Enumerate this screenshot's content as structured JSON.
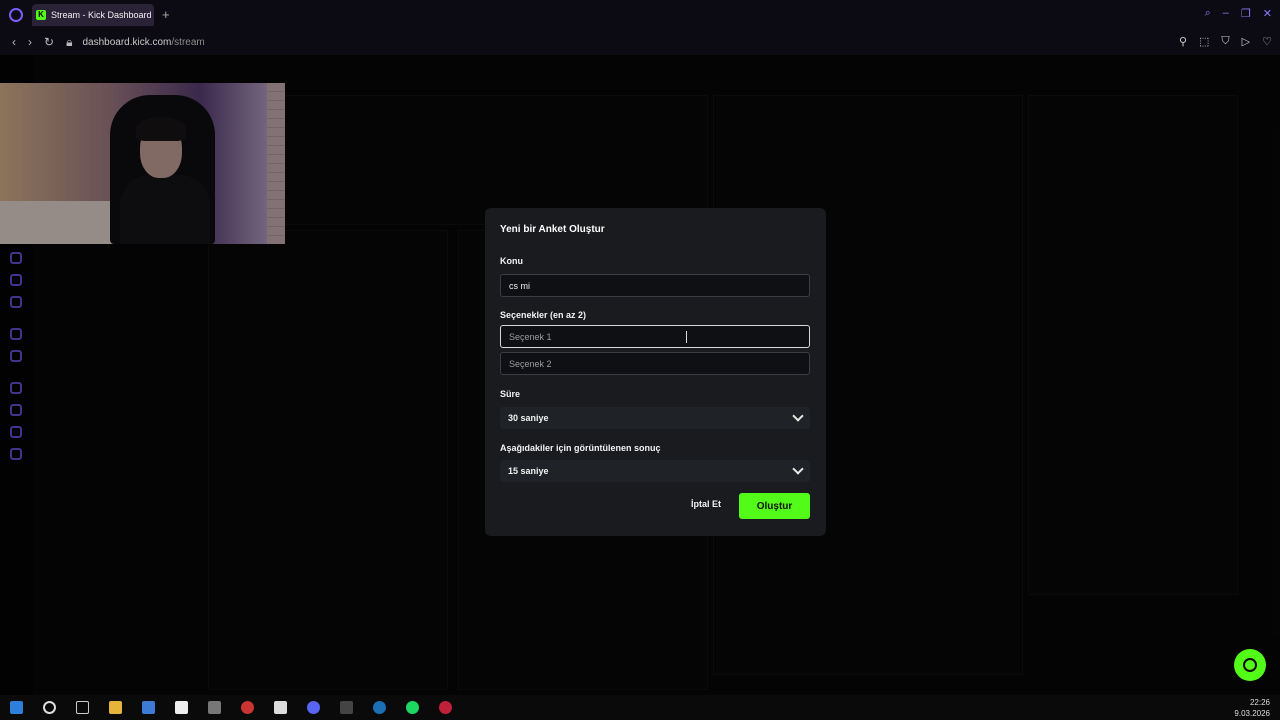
{
  "browser": {
    "tab_title": "Stream - Kick Dashboard",
    "tab_favicon": "K",
    "url_domain": "dashboard.kick.com",
    "url_path": "/stream"
  },
  "modal": {
    "title": "Yeni bir Anket Oluştur",
    "topic_label": "Konu",
    "topic_value": "cs mi",
    "options_label": "Seçenekler (en az 2)",
    "option1_placeholder": "Seçenek 1",
    "option2_placeholder": "Seçenek 2",
    "duration_label": "Süre",
    "duration_value": "30 saniye",
    "result_label": "Aşağıdakiler için görüntülenen sonuç",
    "result_value": "15 saniye",
    "cancel_label": "İptal Et",
    "create_label": "Oluştur"
  },
  "taskbar": {
    "time": "22:26",
    "date": "9.03.2026"
  },
  "colors": {
    "accent": "#53fc18",
    "modal_bg": "#191b1f",
    "opera": "#7c5cff"
  }
}
